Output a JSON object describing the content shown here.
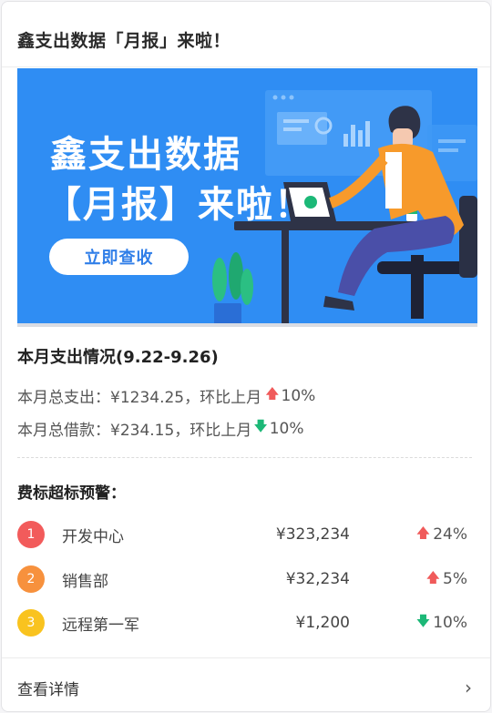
{
  "card": {
    "title": "鑫支出数据「月报」来啦！"
  },
  "banner": {
    "line1": "鑫支出数据",
    "line2": "【月报】来啦！",
    "button_label": "立即查收",
    "background_color": "#2f8df3"
  },
  "summary": {
    "title": "本月支出情况(9.22-9.26)",
    "expense": {
      "label": "本月总支出：¥1234.25，环比上月",
      "direction": "up",
      "change": "10%"
    },
    "loan": {
      "label": "本月总借款：¥234.15，环比上月",
      "direction": "down",
      "change": "10%"
    }
  },
  "warning": {
    "title": "费标超标预警：",
    "items": [
      {
        "rank": "1",
        "name": "开发中心",
        "amount": "¥323,234",
        "direction": "up",
        "change": "24%",
        "rank_color": "#f25b5b"
      },
      {
        "rank": "2",
        "name": "销售部",
        "amount": "¥32,234",
        "direction": "up",
        "change": "5%",
        "rank_color": "#f7913d"
      },
      {
        "rank": "3",
        "name": "远程第一军",
        "amount": "¥1,200",
        "direction": "down",
        "change": "10%",
        "rank_color": "#f9c31f"
      }
    ]
  },
  "footer": {
    "label": "查看详情",
    "icon": "chevron-right-icon"
  },
  "colors": {
    "up": "#f05a5a",
    "down": "#1cb877"
  }
}
